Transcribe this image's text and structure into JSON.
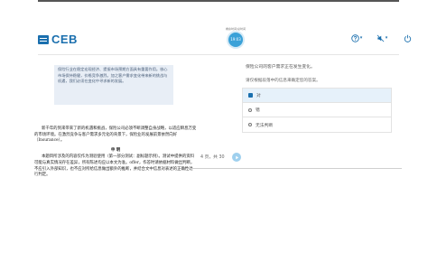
{
  "header": {
    "logo_text": "CEB",
    "timer_label": "剩余时间/总时间",
    "timer_value": "19:03",
    "icons": [
      "help-icon",
      "mute-icon",
      "exit-icon"
    ]
  },
  "notice_text": "保险行业在稳定宏观经济、提振市场预期方面具有重要作用。核心市场保持稳健，价格竞争激烈。加之客户需求变化带来新的挑战与机遇，我们必须在变化中寻求新的发展。",
  "passage": {
    "para1": "新千年的到来带来了新的机遇和挑战，保险公司必须不断调整自身战略，以适应瞬息万变的市场环境。在激烈竞争与客户需求多元化的背景下，保险业的发展前景依然向好（Insurance）。",
    "section_title": "申 明",
    "para2": "本题目所涉及的内容仅作为测验使用（第一部分测试：副标题示例）。测试中提供的资料可能与真实情况存在差异，所有陈述均应以本文为准。offer，作答时请依据材料做出判断，不应引入外部知识，也不应对所给信息做出额外的推断，并结合文中信息对表述的正确性进行判定。"
  },
  "question": {
    "statement": "保险公司的客户需求正在发生变化。",
    "instruction": "请仅根据段落中的信息来确定您的答案。",
    "options": [
      {
        "label": "对",
        "selected": true
      },
      {
        "label": "错",
        "selected": false
      },
      {
        "label": "无法判断",
        "selected": false
      }
    ]
  },
  "pager": {
    "text": "4 页，共 30"
  }
}
